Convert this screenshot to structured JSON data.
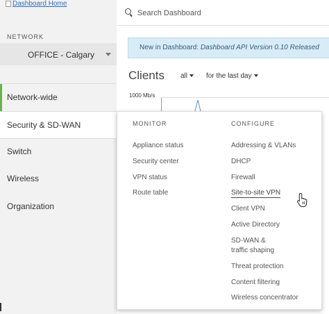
{
  "logo": {
    "alt_text": "Dashboard Home"
  },
  "sidebar": {
    "network_label": "NETWORK",
    "network_selected": "OFFICE - Calgary",
    "items": [
      {
        "label": "Network-wide"
      },
      {
        "label": "Security & SD-WAN"
      },
      {
        "label": "Switch"
      },
      {
        "label": "Wireless"
      },
      {
        "label": "Organization"
      }
    ]
  },
  "search": {
    "placeholder": "Search Dashboard"
  },
  "banner": {
    "prefix": "New in Dashboard: ",
    "link": "Dashboard API Version 0.10 Released"
  },
  "clients": {
    "title": "Clients",
    "filter_type": "all",
    "filter_time": "for the last day",
    "y_axis_label": "1000 Mb/s"
  },
  "menu": {
    "monitor_heading": "MONITOR",
    "configure_heading": "CONFIGURE",
    "monitor": [
      {
        "label": "Appliance status"
      },
      {
        "label": "Security center"
      },
      {
        "label": "VPN status"
      },
      {
        "label": "Route table"
      }
    ],
    "configure": [
      {
        "label": "Addressing & VLANs"
      },
      {
        "label": "DHCP"
      },
      {
        "label": "Firewall"
      },
      {
        "label": "Site-to-site VPN"
      },
      {
        "label": "Client VPN"
      },
      {
        "label": "Active Directory"
      },
      {
        "label": "SD-WAN &"
      },
      {
        "label": "traffic shaping"
      },
      {
        "label": "Threat protection"
      },
      {
        "label": "Content filtering"
      },
      {
        "label": "Wireless concentrator"
      }
    ]
  },
  "colors": {
    "accent_green": "#67b346",
    "banner_bg": "#d8ecf7",
    "link_blue": "#2a6ebb"
  }
}
